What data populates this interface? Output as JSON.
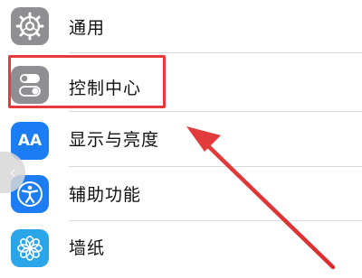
{
  "settings": {
    "items": [
      {
        "label": "通用",
        "icon": "gear-icon"
      },
      {
        "label": "控制中心",
        "icon": "toggle-switches-icon"
      },
      {
        "label": "显示与亮度",
        "icon": "text-size-icon",
        "icon_text": "AA"
      },
      {
        "label": "辅助功能",
        "icon": "accessibility-icon"
      },
      {
        "label": "墙纸",
        "icon": "flower-icon"
      }
    ]
  },
  "annotation": {
    "highlight_color": "#e83a3a",
    "highlighted_item": "控制中心"
  },
  "colors": {
    "gray_icon": "#8e8e93",
    "blue_icon": "#1b7cf4",
    "light_blue_icon": "#2aa5e8"
  }
}
